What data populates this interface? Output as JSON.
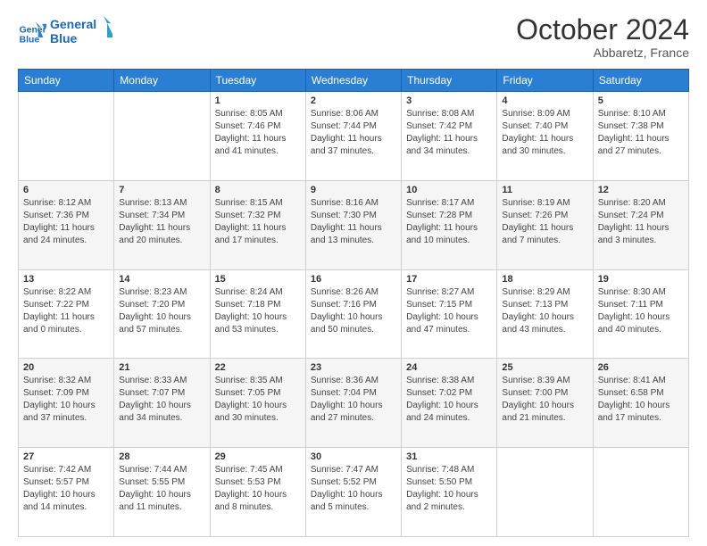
{
  "header": {
    "logo_line1": "General",
    "logo_line2": "Blue",
    "month_title": "October 2024",
    "location": "Abbaretz, France"
  },
  "days_of_week": [
    "Sunday",
    "Monday",
    "Tuesday",
    "Wednesday",
    "Thursday",
    "Friday",
    "Saturday"
  ],
  "weeks": [
    [
      {
        "day": "",
        "sunrise": "",
        "sunset": "",
        "daylight": ""
      },
      {
        "day": "",
        "sunrise": "",
        "sunset": "",
        "daylight": ""
      },
      {
        "day": "1",
        "sunrise": "Sunrise: 8:05 AM",
        "sunset": "Sunset: 7:46 PM",
        "daylight": "Daylight: 11 hours and 41 minutes."
      },
      {
        "day": "2",
        "sunrise": "Sunrise: 8:06 AM",
        "sunset": "Sunset: 7:44 PM",
        "daylight": "Daylight: 11 hours and 37 minutes."
      },
      {
        "day": "3",
        "sunrise": "Sunrise: 8:08 AM",
        "sunset": "Sunset: 7:42 PM",
        "daylight": "Daylight: 11 hours and 34 minutes."
      },
      {
        "day": "4",
        "sunrise": "Sunrise: 8:09 AM",
        "sunset": "Sunset: 7:40 PM",
        "daylight": "Daylight: 11 hours and 30 minutes."
      },
      {
        "day": "5",
        "sunrise": "Sunrise: 8:10 AM",
        "sunset": "Sunset: 7:38 PM",
        "daylight": "Daylight: 11 hours and 27 minutes."
      }
    ],
    [
      {
        "day": "6",
        "sunrise": "Sunrise: 8:12 AM",
        "sunset": "Sunset: 7:36 PM",
        "daylight": "Daylight: 11 hours and 24 minutes."
      },
      {
        "day": "7",
        "sunrise": "Sunrise: 8:13 AM",
        "sunset": "Sunset: 7:34 PM",
        "daylight": "Daylight: 11 hours and 20 minutes."
      },
      {
        "day": "8",
        "sunrise": "Sunrise: 8:15 AM",
        "sunset": "Sunset: 7:32 PM",
        "daylight": "Daylight: 11 hours and 17 minutes."
      },
      {
        "day": "9",
        "sunrise": "Sunrise: 8:16 AM",
        "sunset": "Sunset: 7:30 PM",
        "daylight": "Daylight: 11 hours and 13 minutes."
      },
      {
        "day": "10",
        "sunrise": "Sunrise: 8:17 AM",
        "sunset": "Sunset: 7:28 PM",
        "daylight": "Daylight: 11 hours and 10 minutes."
      },
      {
        "day": "11",
        "sunrise": "Sunrise: 8:19 AM",
        "sunset": "Sunset: 7:26 PM",
        "daylight": "Daylight: 11 hours and 7 minutes."
      },
      {
        "day": "12",
        "sunrise": "Sunrise: 8:20 AM",
        "sunset": "Sunset: 7:24 PM",
        "daylight": "Daylight: 11 hours and 3 minutes."
      }
    ],
    [
      {
        "day": "13",
        "sunrise": "Sunrise: 8:22 AM",
        "sunset": "Sunset: 7:22 PM",
        "daylight": "Daylight: 11 hours and 0 minutes."
      },
      {
        "day": "14",
        "sunrise": "Sunrise: 8:23 AM",
        "sunset": "Sunset: 7:20 PM",
        "daylight": "Daylight: 10 hours and 57 minutes."
      },
      {
        "day": "15",
        "sunrise": "Sunrise: 8:24 AM",
        "sunset": "Sunset: 7:18 PM",
        "daylight": "Daylight: 10 hours and 53 minutes."
      },
      {
        "day": "16",
        "sunrise": "Sunrise: 8:26 AM",
        "sunset": "Sunset: 7:16 PM",
        "daylight": "Daylight: 10 hours and 50 minutes."
      },
      {
        "day": "17",
        "sunrise": "Sunrise: 8:27 AM",
        "sunset": "Sunset: 7:15 PM",
        "daylight": "Daylight: 10 hours and 47 minutes."
      },
      {
        "day": "18",
        "sunrise": "Sunrise: 8:29 AM",
        "sunset": "Sunset: 7:13 PM",
        "daylight": "Daylight: 10 hours and 43 minutes."
      },
      {
        "day": "19",
        "sunrise": "Sunrise: 8:30 AM",
        "sunset": "Sunset: 7:11 PM",
        "daylight": "Daylight: 10 hours and 40 minutes."
      }
    ],
    [
      {
        "day": "20",
        "sunrise": "Sunrise: 8:32 AM",
        "sunset": "Sunset: 7:09 PM",
        "daylight": "Daylight: 10 hours and 37 minutes."
      },
      {
        "day": "21",
        "sunrise": "Sunrise: 8:33 AM",
        "sunset": "Sunset: 7:07 PM",
        "daylight": "Daylight: 10 hours and 34 minutes."
      },
      {
        "day": "22",
        "sunrise": "Sunrise: 8:35 AM",
        "sunset": "Sunset: 7:05 PM",
        "daylight": "Daylight: 10 hours and 30 minutes."
      },
      {
        "day": "23",
        "sunrise": "Sunrise: 8:36 AM",
        "sunset": "Sunset: 7:04 PM",
        "daylight": "Daylight: 10 hours and 27 minutes."
      },
      {
        "day": "24",
        "sunrise": "Sunrise: 8:38 AM",
        "sunset": "Sunset: 7:02 PM",
        "daylight": "Daylight: 10 hours and 24 minutes."
      },
      {
        "day": "25",
        "sunrise": "Sunrise: 8:39 AM",
        "sunset": "Sunset: 7:00 PM",
        "daylight": "Daylight: 10 hours and 21 minutes."
      },
      {
        "day": "26",
        "sunrise": "Sunrise: 8:41 AM",
        "sunset": "Sunset: 6:58 PM",
        "daylight": "Daylight: 10 hours and 17 minutes."
      }
    ],
    [
      {
        "day": "27",
        "sunrise": "Sunrise: 7:42 AM",
        "sunset": "Sunset: 5:57 PM",
        "daylight": "Daylight: 10 hours and 14 minutes."
      },
      {
        "day": "28",
        "sunrise": "Sunrise: 7:44 AM",
        "sunset": "Sunset: 5:55 PM",
        "daylight": "Daylight: 10 hours and 11 minutes."
      },
      {
        "day": "29",
        "sunrise": "Sunrise: 7:45 AM",
        "sunset": "Sunset: 5:53 PM",
        "daylight": "Daylight: 10 hours and 8 minutes."
      },
      {
        "day": "30",
        "sunrise": "Sunrise: 7:47 AM",
        "sunset": "Sunset: 5:52 PM",
        "daylight": "Daylight: 10 hours and 5 minutes."
      },
      {
        "day": "31",
        "sunrise": "Sunrise: 7:48 AM",
        "sunset": "Sunset: 5:50 PM",
        "daylight": "Daylight: 10 hours and 2 minutes."
      },
      {
        "day": "",
        "sunrise": "",
        "sunset": "",
        "daylight": ""
      },
      {
        "day": "",
        "sunrise": "",
        "sunset": "",
        "daylight": ""
      }
    ]
  ]
}
